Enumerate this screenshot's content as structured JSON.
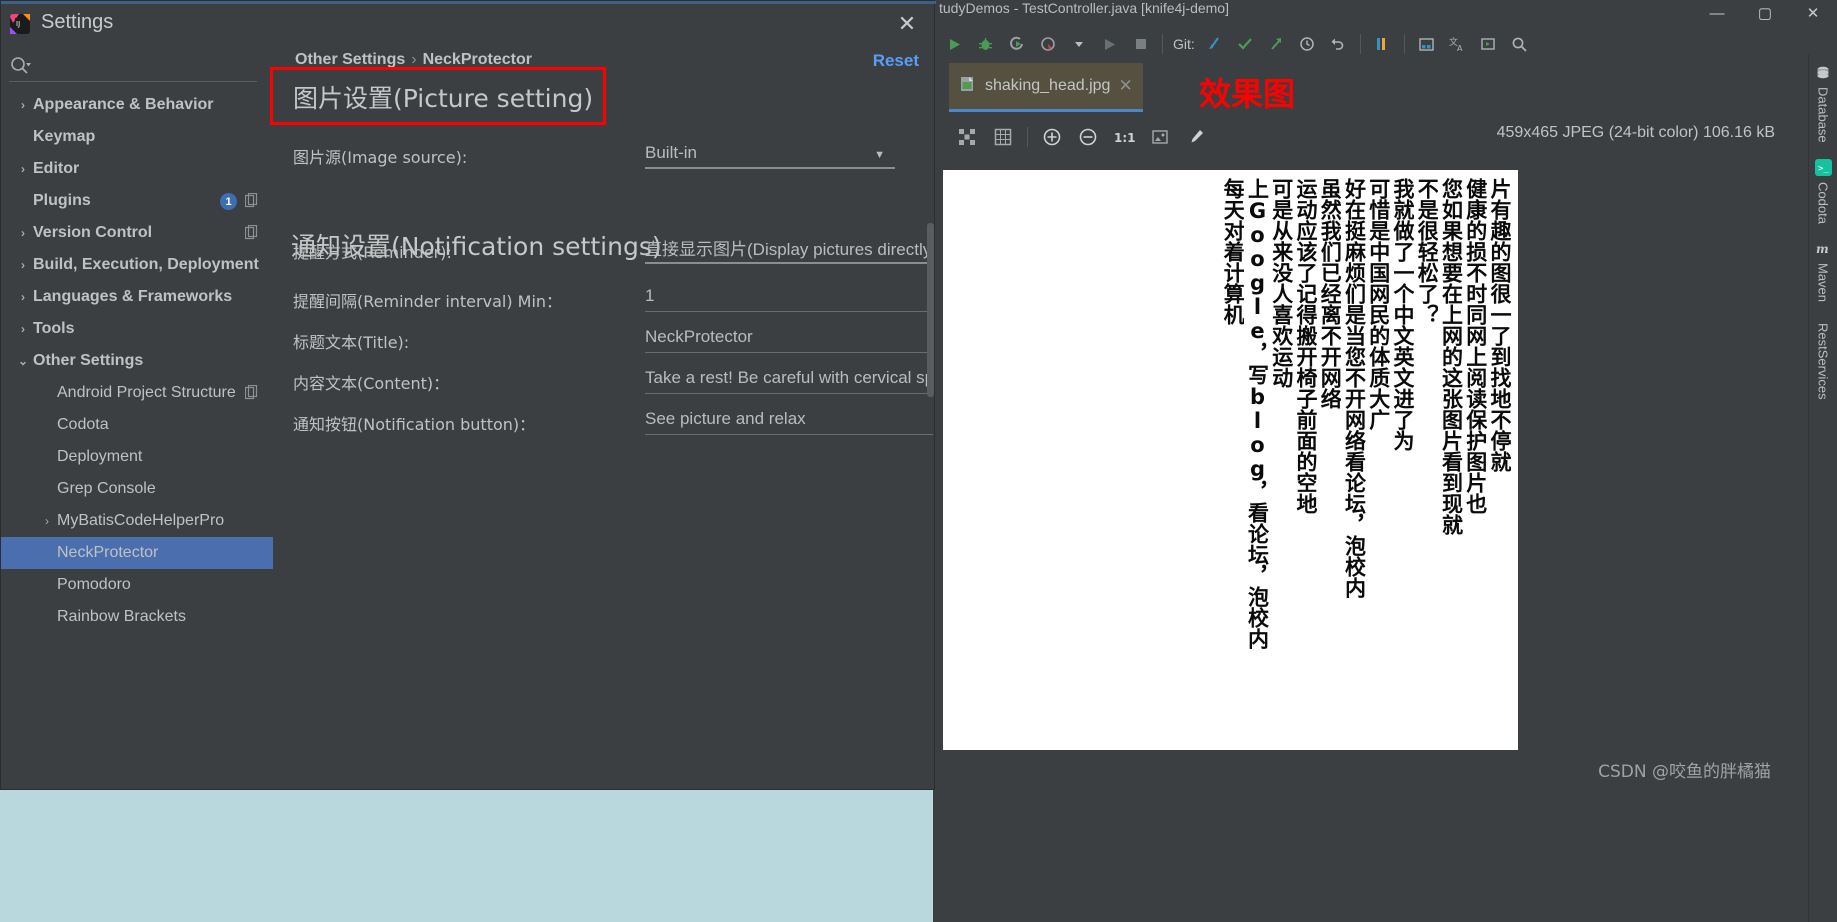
{
  "ide": {
    "window_title": "tudyDemos - TestController.java [knife4j-demo]",
    "window_buttons": {
      "minimize": "—",
      "maximize": "▢",
      "close": "✕"
    },
    "toolbar": {
      "git_label": "Git:",
      "icons": [
        "run-icon",
        "debug-icon",
        "run-with-coverage-icon",
        "profile-icon",
        "dropdown-caret-icon",
        "run-alt-icon",
        "stop-icon",
        "git-update-icon",
        "git-commit-icon",
        "git-push-icon",
        "history-icon",
        "rollback-icon",
        "bookmark-icon",
        "project-structure-icon",
        "translate-icon",
        "console-icon",
        "search-everywhere-icon"
      ]
    },
    "editor_tab": {
      "filename": "shaking_head.jpg",
      "close": "✕"
    },
    "annotation_label": "效果图",
    "image_toolbar_icons": [
      "fit-icon",
      "grid-icon",
      "zoom-in-icon",
      "zoom-out-icon",
      "actual-size-icon",
      "fit-to-window-icon",
      "color-picker-icon"
    ],
    "image_info": "459x465 JPEG (24-bit color) 106.16 kB",
    "watermark": "CSDN @咬鱼的胖橘猫",
    "right_rail": [
      {
        "label": "Database",
        "icon": "database-icon"
      },
      {
        "label": "Codota",
        "icon": "codota-icon"
      },
      {
        "label": "Maven",
        "icon": "maven-icon"
      },
      {
        "label": "RestServices",
        "icon": "rest-services-icon"
      }
    ],
    "image_columns": [
      "片有趣的图很一了到找地不停就",
      "健康的损不时同网上阅读保护图片也",
      "您如果想要在上网的这张图片看到现就",
      "不是很轻松了？",
      "我就做了一个中文英文进了为",
      "可惜是中国网民的体质大广",
      "好在挺麻烦们是当您不开网络看论坛，泡校内",
      "虽然我们已经离不开网络",
      "运动应该了记得搬开椅子前面的空地",
      "可是从来没人喜欢运动",
      "上Google，写blog，看论坛，泡校内",
      "每天对着计算机"
    ]
  },
  "settings": {
    "title": "Settings",
    "logo": "intellij-idea-logo",
    "close": "✕",
    "search": {
      "icon": "search-icon",
      "placeholder": ""
    },
    "tree": [
      {
        "label": "Appearance & Behavior",
        "chevron": "›",
        "bold": true,
        "indent": 0,
        "selected": false
      },
      {
        "label": "Keymap",
        "chevron": "",
        "bold": true,
        "indent": 0,
        "selected": false
      },
      {
        "label": "Editor",
        "chevron": "›",
        "bold": true,
        "indent": 0,
        "selected": false
      },
      {
        "label": "Plugins",
        "chevron": "",
        "bold": true,
        "indent": 0,
        "selected": false,
        "badge": "1",
        "copy_icon": true
      },
      {
        "label": "Version Control",
        "chevron": "›",
        "bold": true,
        "indent": 0,
        "selected": false,
        "copy_icon": true
      },
      {
        "label": "Build, Execution, Deployment",
        "chevron": "›",
        "bold": true,
        "indent": 0,
        "selected": false
      },
      {
        "label": "Languages & Frameworks",
        "chevron": "›",
        "bold": true,
        "indent": 0,
        "selected": false
      },
      {
        "label": "Tools",
        "chevron": "›",
        "bold": true,
        "indent": 0,
        "selected": false
      },
      {
        "label": "Other Settings",
        "chevron": "⌄",
        "bold": true,
        "indent": 0,
        "selected": false
      },
      {
        "label": "Android Project Structure",
        "chevron": "",
        "bold": false,
        "indent": 1,
        "selected": false,
        "copy_icon": true
      },
      {
        "label": "Codota",
        "chevron": "",
        "bold": false,
        "indent": 1,
        "selected": false
      },
      {
        "label": "Deployment",
        "chevron": "",
        "bold": false,
        "indent": 1,
        "selected": false
      },
      {
        "label": "Grep Console",
        "chevron": "",
        "bold": false,
        "indent": 1,
        "selected": false
      },
      {
        "label": "MyBatisCodeHelperPro",
        "chevron": "›",
        "bold": false,
        "indent": 1,
        "selected": false
      },
      {
        "label": "NeckProtector",
        "chevron": "",
        "bold": false,
        "indent": 1,
        "selected": true
      },
      {
        "label": "Pomodoro",
        "chevron": "",
        "bold": false,
        "indent": 1,
        "selected": false
      },
      {
        "label": "Rainbow Brackets",
        "chevron": "",
        "bold": false,
        "indent": 1,
        "selected": false
      }
    ],
    "breadcrumb": {
      "root": "Other Settings",
      "separator": "›",
      "leaf": "NeckProtector"
    },
    "reset_label": "Reset",
    "sections": {
      "picture": {
        "title": "图片设置(Picture setting)",
        "image_source_label": "图片源(Image source):",
        "image_source_value": "Built-in"
      },
      "notification": {
        "title": "通知设置(Notification settings)",
        "reminder_label": "提醒方式(Reminder):",
        "reminder_value": "直接显示图片(Display pictures directly)",
        "interval_label": "提醒间隔(Reminder interval) Min：",
        "interval_value": "1",
        "title_label": "标题文本(Title):",
        "title_value": "NeckProtector",
        "content_label": "内容文本(Content)：",
        "content_value": "Take a rest! Be careful with cervical spo",
        "button_label": "通知按钮(Notification button)：",
        "button_value": "See picture and relax"
      }
    }
  },
  "colors": {
    "accent_blue": "#4b6eaf",
    "link_blue": "#589df6",
    "red_highlight": "#ff0000",
    "panel_bg": "#3c3f41",
    "desktop_bg": "#b9d8de",
    "tab_bg": "#55503f"
  }
}
